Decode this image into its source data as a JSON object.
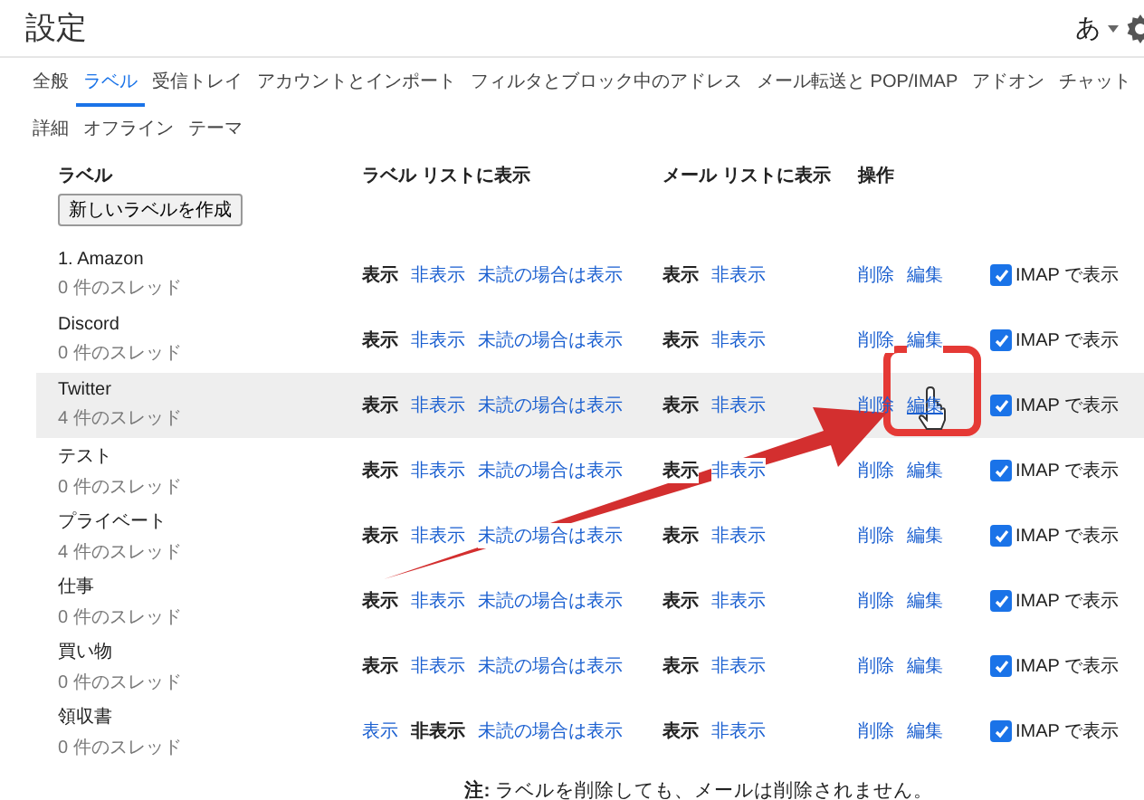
{
  "title": "設定",
  "input_tool": "あ",
  "tabs": [
    {
      "label": "全般",
      "selected": false
    },
    {
      "label": "ラベル",
      "selected": true
    },
    {
      "label": "受信トレイ",
      "selected": false
    },
    {
      "label": "アカウントとインポート",
      "selected": false
    },
    {
      "label": "フィルタとブロック中のアドレス",
      "selected": false
    },
    {
      "label": "メール転送と POP/IMAP",
      "selected": false
    },
    {
      "label": "アドオン",
      "selected": false
    },
    {
      "label": "チャット",
      "selected": false
    },
    {
      "label": "詳細",
      "selected": false
    },
    {
      "label": "オフライン",
      "selected": false
    },
    {
      "label": "テーマ",
      "selected": false
    }
  ],
  "table": {
    "columns": [
      "ラベル",
      "ラベル リストに表示",
      "メール リストに表示",
      "操作"
    ],
    "create_button": "新しいラベルを作成",
    "rows": [
      {
        "name": "1. Amazon",
        "count": "0 件のスレッド",
        "highlighted": false,
        "label_list": [
          {
            "text": "表示",
            "selected": true
          },
          {
            "text": "非表示",
            "selected": false
          },
          {
            "text": "未読の場合は表示",
            "selected": false
          }
        ],
        "message_list": [
          {
            "text": "表示",
            "selected": true
          },
          {
            "text": "非表示",
            "selected": false
          }
        ],
        "actions": [
          {
            "text": "削除",
            "hovered": false
          },
          {
            "text": "編集",
            "hovered": false
          }
        ],
        "imap": {
          "label": "IMAP で表示",
          "checked": true
        }
      },
      {
        "name": "Discord",
        "count": "0 件のスレッド",
        "highlighted": false,
        "label_list": [
          {
            "text": "表示",
            "selected": true
          },
          {
            "text": "非表示",
            "selected": false
          },
          {
            "text": "未読の場合は表示",
            "selected": false
          }
        ],
        "message_list": [
          {
            "text": "表示",
            "selected": true
          },
          {
            "text": "非表示",
            "selected": false
          }
        ],
        "actions": [
          {
            "text": "削除",
            "hovered": false
          },
          {
            "text": "編集",
            "hovered": false
          }
        ],
        "imap": {
          "label": "IMAP で表示",
          "checked": true
        }
      },
      {
        "name": "Twitter",
        "count": "4 件のスレッド",
        "highlighted": true,
        "label_list": [
          {
            "text": "表示",
            "selected": true
          },
          {
            "text": "非表示",
            "selected": false
          },
          {
            "text": "未読の場合は表示",
            "selected": false
          }
        ],
        "message_list": [
          {
            "text": "表示",
            "selected": true
          },
          {
            "text": "非表示",
            "selected": false
          }
        ],
        "actions": [
          {
            "text": "削除",
            "hovered": false
          },
          {
            "text": "編集",
            "hovered": true
          }
        ],
        "imap": {
          "label": "IMAP で表示",
          "checked": true
        }
      },
      {
        "name": "テスト",
        "count": "0 件のスレッド",
        "highlighted": false,
        "label_list": [
          {
            "text": "表示",
            "selected": true
          },
          {
            "text": "非表示",
            "selected": false
          },
          {
            "text": "未読の場合は表示",
            "selected": false
          }
        ],
        "message_list": [
          {
            "text": "表示",
            "selected": true
          },
          {
            "text": "非表示",
            "selected": false
          }
        ],
        "actions": [
          {
            "text": "削除",
            "hovered": false
          },
          {
            "text": "編集",
            "hovered": false
          }
        ],
        "imap": {
          "label": "IMAP で表示",
          "checked": true
        }
      },
      {
        "name": "プライベート",
        "count": "4 件のスレッド",
        "highlighted": false,
        "label_list": [
          {
            "text": "表示",
            "selected": true
          },
          {
            "text": "非表示",
            "selected": false
          },
          {
            "text": "未読の場合は表示",
            "selected": false
          }
        ],
        "message_list": [
          {
            "text": "表示",
            "selected": true
          },
          {
            "text": "非表示",
            "selected": false
          }
        ],
        "actions": [
          {
            "text": "削除",
            "hovered": false
          },
          {
            "text": "編集",
            "hovered": false
          }
        ],
        "imap": {
          "label": "IMAP で表示",
          "checked": true
        }
      },
      {
        "name": "仕事",
        "count": "0 件のスレッド",
        "highlighted": false,
        "label_list": [
          {
            "text": "表示",
            "selected": true
          },
          {
            "text": "非表示",
            "selected": false
          },
          {
            "text": "未読の場合は表示",
            "selected": false
          }
        ],
        "message_list": [
          {
            "text": "表示",
            "selected": true
          },
          {
            "text": "非表示",
            "selected": false
          }
        ],
        "actions": [
          {
            "text": "削除",
            "hovered": false
          },
          {
            "text": "編集",
            "hovered": false
          }
        ],
        "imap": {
          "label": "IMAP で表示",
          "checked": true
        }
      },
      {
        "name": "買い物",
        "count": "0 件のスレッド",
        "highlighted": false,
        "label_list": [
          {
            "text": "表示",
            "selected": true
          },
          {
            "text": "非表示",
            "selected": false
          },
          {
            "text": "未読の場合は表示",
            "selected": false
          }
        ],
        "message_list": [
          {
            "text": "表示",
            "selected": true
          },
          {
            "text": "非表示",
            "selected": false
          }
        ],
        "actions": [
          {
            "text": "削除",
            "hovered": false
          },
          {
            "text": "編集",
            "hovered": false
          }
        ],
        "imap": {
          "label": "IMAP で表示",
          "checked": true
        }
      },
      {
        "name": "領収書",
        "count": "0 件のスレッド",
        "highlighted": false,
        "label_list": [
          {
            "text": "表示",
            "selected": false
          },
          {
            "text": "非表示",
            "selected": true
          },
          {
            "text": "未読の場合は表示",
            "selected": false
          }
        ],
        "message_list": [
          {
            "text": "表示",
            "selected": true
          },
          {
            "text": "非表示",
            "selected": false
          }
        ],
        "actions": [
          {
            "text": "削除",
            "hovered": false
          },
          {
            "text": "編集",
            "hovered": false
          }
        ],
        "imap": {
          "label": "IMAP で表示",
          "checked": true
        }
      }
    ]
  },
  "note": "**注:** ラベルを削除しても、メールは削除されません。"
}
